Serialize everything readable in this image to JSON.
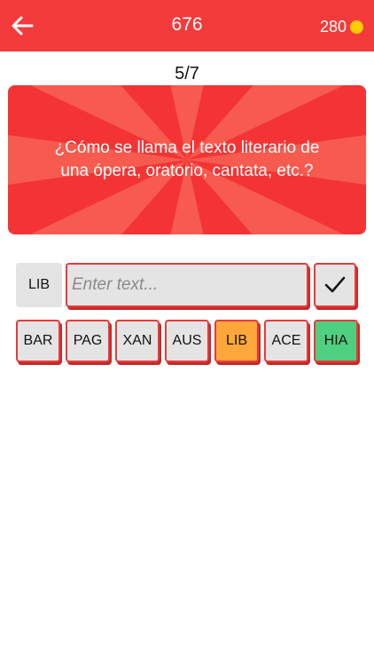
{
  "header": {
    "title": "676",
    "coins": "280",
    "back_icon": "arrow-left-icon",
    "coin_icon": "coin-icon",
    "bg_color": "#f43b3b"
  },
  "progress": "5/7",
  "question": {
    "line1": "¿Cómo se llama el texto literario de",
    "line2": "una ópera, oratorio, cantata, etc.?"
  },
  "answer": {
    "label": "LIB",
    "value": "",
    "placeholder": "Enter text...",
    "submit_icon": "checkmark-icon"
  },
  "options": [
    {
      "label": "BAR",
      "state": "default"
    },
    {
      "label": "PAG",
      "state": "default"
    },
    {
      "label": "XAN",
      "state": "default"
    },
    {
      "label": "AUS",
      "state": "default"
    },
    {
      "label": "LIB",
      "state": "selected",
      "color": "#ffa73a"
    },
    {
      "label": "ACE",
      "state": "default"
    },
    {
      "label": "HIA",
      "state": "hint",
      "color": "#4fcf80"
    }
  ]
}
